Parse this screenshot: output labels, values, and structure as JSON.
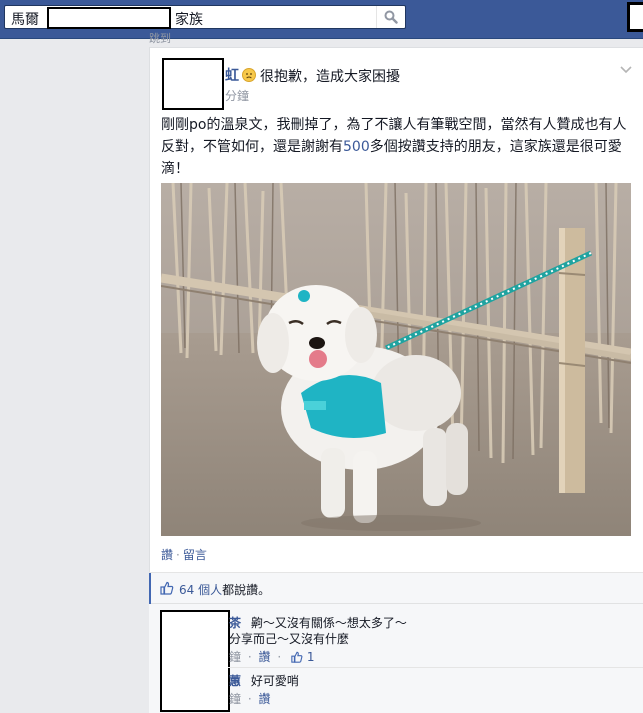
{
  "search": {
    "query_prefix": "馬爾",
    "query_suffix": "家族"
  },
  "header_fragment": "跳到",
  "post": {
    "author": "虹",
    "feeling": "很抱歉，造成大家困擾",
    "time": "分鐘",
    "text_before": "剛剛po的溫泉文，我刪掉了，為了不讓人有筆戰空間，當然有人贊成也有人反對，不管如何，還是謝謝有",
    "text_number": "500",
    "text_after": "多個按讚支持的朋友，這家族還是很可愛滴！",
    "actions": {
      "like": "讚",
      "separator": "·",
      "comment": "留言"
    }
  },
  "likes": {
    "count_link": "64 個人",
    "suffix": "都說讚。"
  },
  "comments": [
    {
      "name": "茶",
      "line1": "齁～又沒有關係～想太多了～",
      "line2": "分享而己～又沒有什麼",
      "meta_time": "鐘",
      "meta_like": "讚",
      "meta_separator": "·",
      "like_count": "1"
    },
    {
      "name": "蕙",
      "text": "好可愛哨",
      "meta_time": "鐘",
      "meta_like": "讚",
      "meta_separator": "·"
    }
  ],
  "colors": {
    "topbar": "#3b5998",
    "link": "#3b5998",
    "background": "#e9eaed",
    "comment_bg": "#f6f7f9"
  },
  "icons": [
    "search-icon",
    "sad-emoji-icon",
    "chevron-down-icon",
    "like-thumb-icon"
  ]
}
